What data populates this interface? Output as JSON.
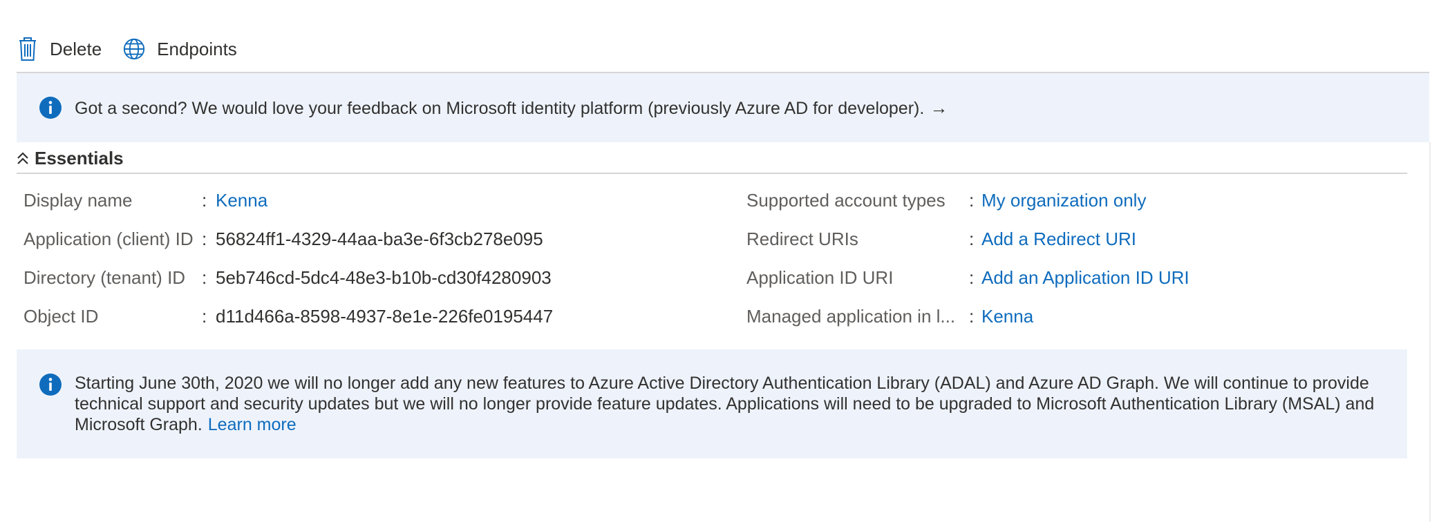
{
  "toolbar": {
    "delete_label": "Delete",
    "endpoints_label": "Endpoints"
  },
  "feedback_banner": {
    "text": "Got a second? We would love your feedback on Microsoft identity platform (previously Azure AD for developer).",
    "arrow": "→"
  },
  "essentials": {
    "heading": "Essentials",
    "left": [
      {
        "label": "Display name",
        "value": "Kenna",
        "is_link": true
      },
      {
        "label": "Application (client) ID",
        "value": "56824ff1-4329-44aa-ba3e-6f3cb278e095",
        "is_link": false
      },
      {
        "label": "Directory (tenant) ID",
        "value": "5eb746cd-5dc4-48e3-b10b-cd30f4280903",
        "is_link": false
      },
      {
        "label": "Object ID",
        "value": "d11d466a-8598-4937-8e1e-226fe0195447",
        "is_link": false
      }
    ],
    "right": [
      {
        "label": "Supported account types",
        "value": "My organization only",
        "is_link": true
      },
      {
        "label": "Redirect URIs",
        "value": "Add a Redirect URI",
        "is_link": true
      },
      {
        "label": "Application ID URI",
        "value": "Add an Application ID URI",
        "is_link": true
      },
      {
        "label": "Managed application in l...",
        "value": "Kenna",
        "is_link": true
      }
    ],
    "separator": ":"
  },
  "adal_banner": {
    "text": "Starting June 30th, 2020 we will no longer add any new features to Azure Active Directory Authentication Library (ADAL) and Azure AD Graph. We will continue to provide technical support and security updates but we will no longer provide feature updates. Applications will need to be upgraded to Microsoft Authentication Library (MSAL) and Microsoft Graph.",
    "learn_more": "Learn more"
  },
  "colors": {
    "link": "#0f6cbd",
    "info_icon": "#0f6cbd",
    "banner_bg": "#eef3fb",
    "label": "#605e5c",
    "text": "#323130"
  },
  "icons": {
    "delete": "trash-icon",
    "endpoints": "globe-icon",
    "info": "info-icon",
    "collapse": "chevron-double-up-icon"
  }
}
